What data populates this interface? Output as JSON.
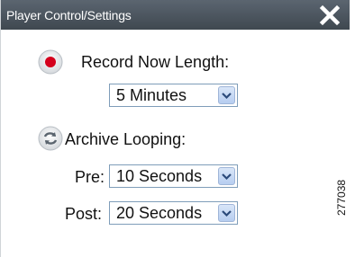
{
  "window": {
    "title": "Player Control/Settings",
    "close_icon": "close-icon"
  },
  "record_now": {
    "label": "Record Now Length:",
    "icon": "record-icon",
    "value": "5 Minutes"
  },
  "archive_looping": {
    "label": "Archive Looping:",
    "icon": "loop-icon",
    "pre_label": "Pre:",
    "pre_value": "10 Seconds",
    "post_label": "Post:",
    "post_value": "20 Seconds"
  },
  "figure_id": "277038",
  "colors": {
    "titlebar": "#4b545d",
    "record_red": "#d4001c",
    "select_border": "#7f9db9"
  }
}
